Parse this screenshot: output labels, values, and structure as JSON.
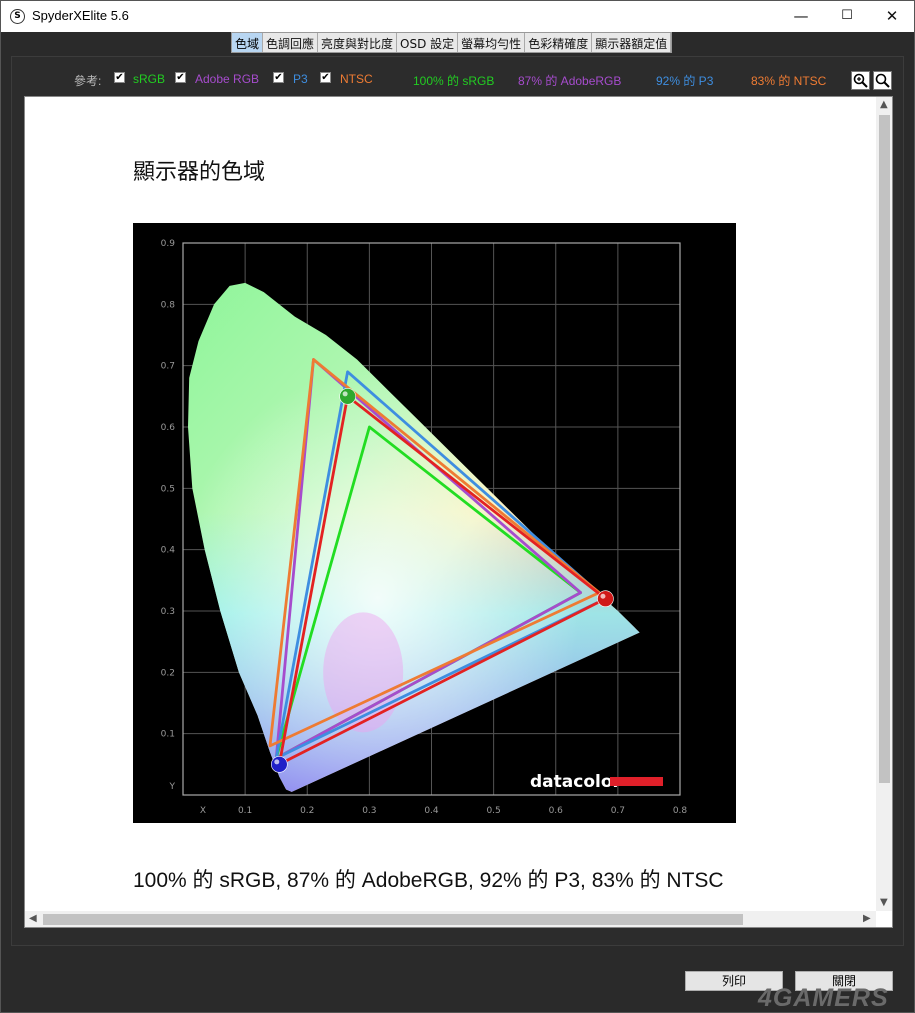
{
  "window": {
    "title": "SpyderXElite 5.6",
    "app_icon": "S"
  },
  "window_controls": {
    "minimize": "—",
    "maximize": "☐",
    "close": "✕"
  },
  "tabs": [
    {
      "label": "色域",
      "active": true
    },
    {
      "label": "色調回應"
    },
    {
      "label": "亮度與對比度"
    },
    {
      "label": "OSD 設定"
    },
    {
      "label": "螢幕均勻性"
    },
    {
      "label": "色彩精確度"
    },
    {
      "label": "顯示器額定值"
    }
  ],
  "reference": {
    "label": "參考:",
    "items": [
      {
        "name": "sRGB",
        "checked": true,
        "color": "#22cc22"
      },
      {
        "name": "Adobe RGB",
        "checked": true,
        "color": "#a64ccd"
      },
      {
        "name": "P3",
        "checked": true,
        "color": "#3e8ee0"
      },
      {
        "name": "NTSC",
        "checked": true,
        "color": "#ee7b33"
      }
    ],
    "results": [
      {
        "text": "100% 的 sRGB",
        "color": "#22cc22"
      },
      {
        "text": "87% 的 AdobeRGB",
        "color": "#a64ccd"
      },
      {
        "text": "92% 的 P3",
        "color": "#3e8ee0"
      },
      {
        "text": "83% 的 NTSC",
        "color": "#ee7b33"
      }
    ]
  },
  "content": {
    "heading": "顯示器的色域",
    "summary": "100% 的 sRGB, 87% 的 AdobeRGB, 92% 的 P3, 83% 的 NTSC"
  },
  "chart_data": {
    "type": "scatter",
    "title": "",
    "xlabel": "X",
    "ylabel": "Y",
    "xlim": [
      0,
      0.8
    ],
    "ylim": [
      0,
      0.9
    ],
    "x_ticks": [
      "0.1",
      "0.2",
      "0.3",
      "0.4",
      "0.5",
      "0.6",
      "0.7",
      "0.8"
    ],
    "y_ticks": [
      "0.1",
      "0.2",
      "0.3",
      "0.4",
      "0.5",
      "0.6",
      "0.7",
      "0.8",
      "0.9"
    ],
    "grid": true,
    "brand": "datacolor",
    "series": [
      {
        "name": "sRGB",
        "color": "#22dd22",
        "points": [
          [
            0.64,
            0.33
          ],
          [
            0.3,
            0.6
          ],
          [
            0.15,
            0.06
          ]
        ]
      },
      {
        "name": "Adobe RGB",
        "color": "#a64ccd",
        "points": [
          [
            0.64,
            0.33
          ],
          [
            0.21,
            0.71
          ],
          [
            0.15,
            0.06
          ]
        ]
      },
      {
        "name": "P3",
        "color": "#3e8ee0",
        "points": [
          [
            0.68,
            0.32
          ],
          [
            0.265,
            0.69
          ],
          [
            0.15,
            0.06
          ]
        ]
      },
      {
        "name": "NTSC",
        "color": "#ee7b33",
        "points": [
          [
            0.67,
            0.33
          ],
          [
            0.21,
            0.71
          ],
          [
            0.14,
            0.08
          ]
        ]
      },
      {
        "name": "",
        "color": "#e32222",
        "points": [
          [
            0.68,
            0.32
          ],
          [
            0.265,
            0.65
          ],
          [
            0.155,
            0.05
          ]
        ]
      }
    ],
    "primaries": [
      {
        "color": "#d01818",
        "x": 0.68,
        "y": 0.32
      },
      {
        "color": "#2ea82e",
        "x": 0.265,
        "y": 0.65
      },
      {
        "color": "#2020c8",
        "x": 0.155,
        "y": 0.05
      }
    ]
  },
  "buttons": {
    "print": "列印",
    "close": "關閉"
  },
  "watermark": "4GAMERS"
}
